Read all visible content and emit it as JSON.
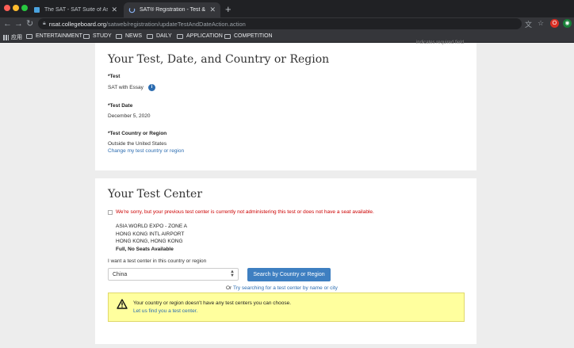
{
  "browser": {
    "tabs": [
      {
        "title": "The SAT - SAT Suite of Assessments",
        "active": false
      },
      {
        "title": "SAT® Registration - Test & Center",
        "active": true
      }
    ],
    "url_host": "nsat.collegeboard.org",
    "url_path": "/satweb/registration/updateTestAndDateAction.action",
    "profile_initial": "O",
    "bookmarks": [
      "应用",
      "ENTERTAINMENT",
      "STUDY",
      "NEWS",
      "DAILY",
      "APPLICATION",
      "COMPETITION"
    ]
  },
  "section1": {
    "cut_note": "indicates required field",
    "title": "Your Test, Date, and Country or Region",
    "test_label": "*Test",
    "test_value": "SAT with Essay",
    "date_label": "*Test Date",
    "date_value": "December 5, 2020",
    "country_label": "*Test Country or Region",
    "country_value": "Outside the United States",
    "change_link": "Change my test country or region"
  },
  "section2": {
    "title": "Your Test Center",
    "error": "We're sorry, but your previous test center is currently not administering this test or does not have a seat available.",
    "center_lines": [
      "ASIA WORLD EXPO - ZONE A",
      "HONG KONG INTL AIRPORT",
      "HONG KONG, HONG KONG"
    ],
    "seats": "Full, No Seats Available",
    "country_prompt": "I want a test center in this country or region",
    "country_selected": "China",
    "search_button": "Search by Country or Region",
    "or_text": "Or",
    "search_link": "Try searching for a test center by name or city",
    "warn_text": "Your country or region doesn't have any test centers you can choose.",
    "warn_link": "Let us find you a test center."
  },
  "colors": {
    "accent": "#3e7fc1",
    "error": "#cc0000",
    "warning_bg": "#ffff9e",
    "link": "#2b6cb0"
  }
}
